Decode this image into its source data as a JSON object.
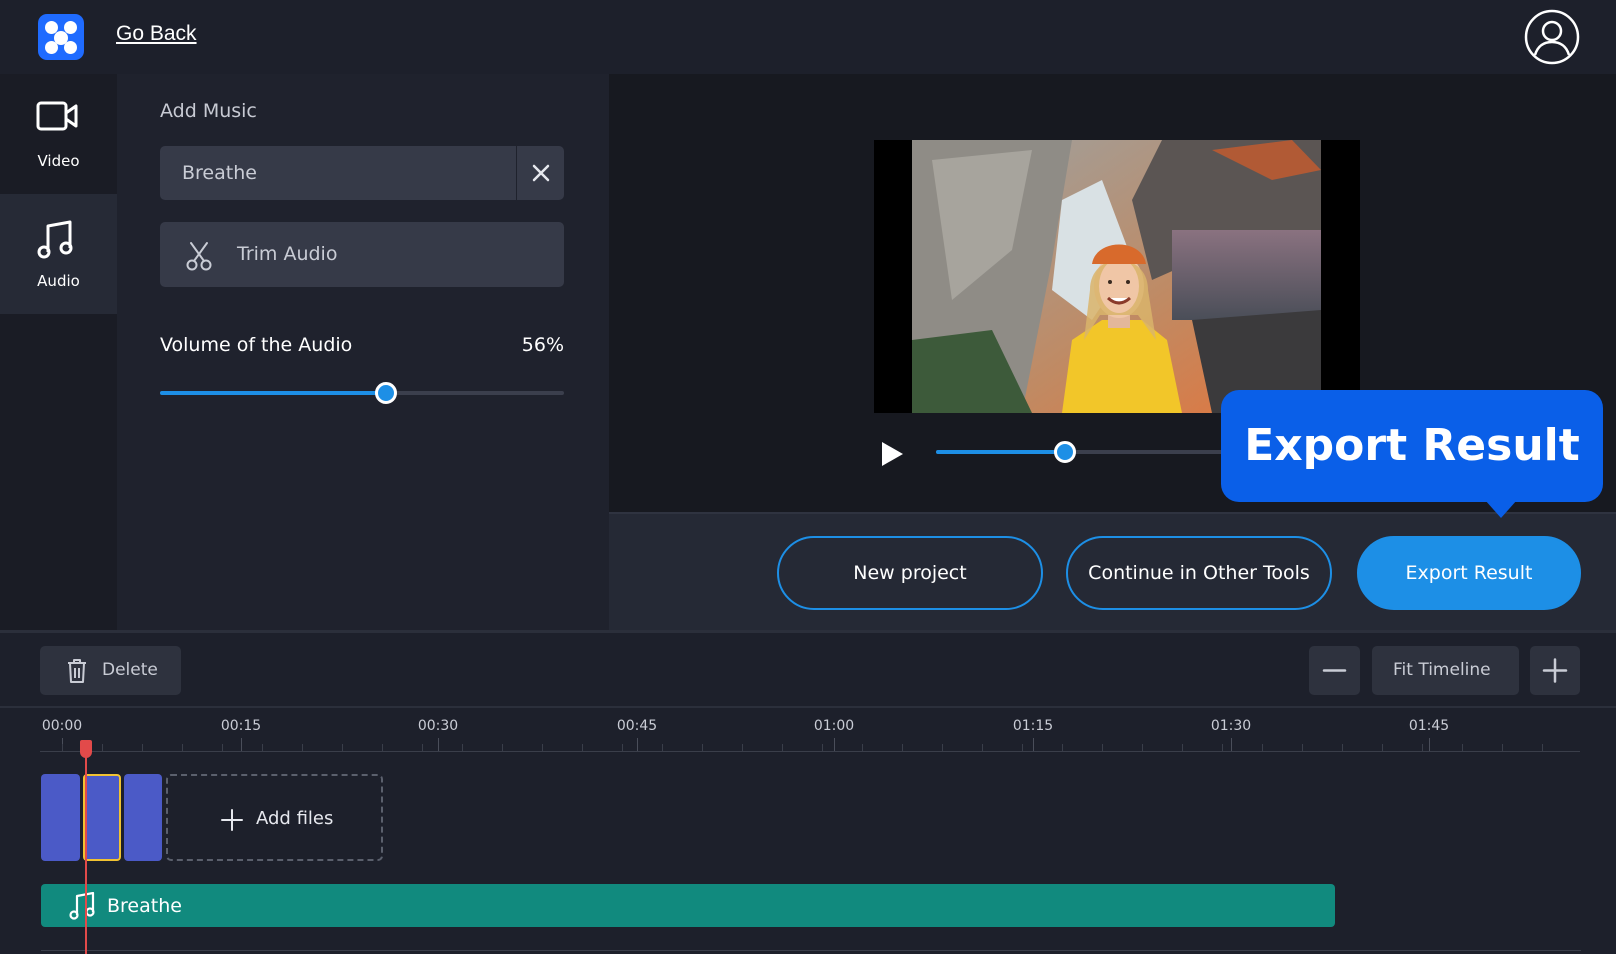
{
  "header": {
    "back_label": "Go Back"
  },
  "sidebar": {
    "items": [
      {
        "label": "Video",
        "icon": "video-camera-icon",
        "active": false
      },
      {
        "label": "Audio",
        "icon": "music-note-icon",
        "active": true
      }
    ]
  },
  "panel": {
    "title": "Add Music",
    "music_value": "Breathe",
    "trim_label": "Trim Audio",
    "volume_label": "Volume of the Audio",
    "volume_value": "56%",
    "volume_percent": 56
  },
  "player": {
    "progress_percent": 43
  },
  "tooltip": {
    "text": "Export Result"
  },
  "actions": {
    "new_project": "New project",
    "continue": "Continue in Other Tools",
    "export": "Export Result"
  },
  "timeline": {
    "delete_label": "Delete",
    "fit_label": "Fit Timeline",
    "ticks": [
      "00:00",
      "00:15",
      "00:30",
      "00:45",
      "01:00",
      "01:15",
      "01:30",
      "01:45"
    ],
    "add_files_label": "Add files",
    "audio_track_label": "Breathe"
  },
  "colors": {
    "accent": "#1d8fe6",
    "audio_track": "#118a7e",
    "clip": "#4b5ac7",
    "playhead": "#e24a4a",
    "tooltip": "#0a5fe8"
  }
}
